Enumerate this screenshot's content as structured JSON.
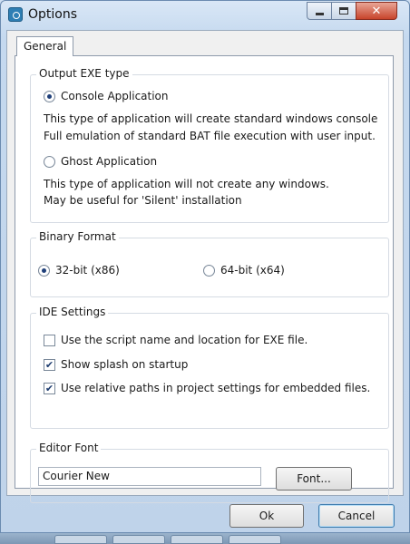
{
  "window": {
    "title": "Options",
    "icon": "app-icon"
  },
  "tabs": [
    {
      "label": "General",
      "selected": true
    }
  ],
  "output_exe": {
    "legend": "Output EXE type",
    "console": {
      "label": "Console Application",
      "selected": true,
      "desc_line1": "This type of application will create standard windows console",
      "desc_line2": "Full emulation of standard BAT file execution with user input."
    },
    "ghost": {
      "label": "Ghost Application",
      "selected": false,
      "desc_line1": "This type of application will not create any windows.",
      "desc_line2": "May be useful for 'Silent' installation"
    }
  },
  "binary_format": {
    "legend": "Binary Format",
    "opt32": {
      "label": "32-bit (x86)",
      "selected": true
    },
    "opt64": {
      "label": "64-bit (x64)",
      "selected": false
    }
  },
  "ide_settings": {
    "legend": "IDE Settings",
    "items": [
      {
        "label": "Use the script name and location for EXE file.",
        "checked": false
      },
      {
        "label": "Show splash on startup",
        "checked": true
      },
      {
        "label": "Use relative paths in project settings for embedded files.",
        "checked": true
      }
    ]
  },
  "editor_font": {
    "legend": "Editor Font",
    "value": "Courier New",
    "button_label": "Font..."
  },
  "footer": {
    "ok_label": "Ok",
    "cancel_label": "Cancel"
  }
}
